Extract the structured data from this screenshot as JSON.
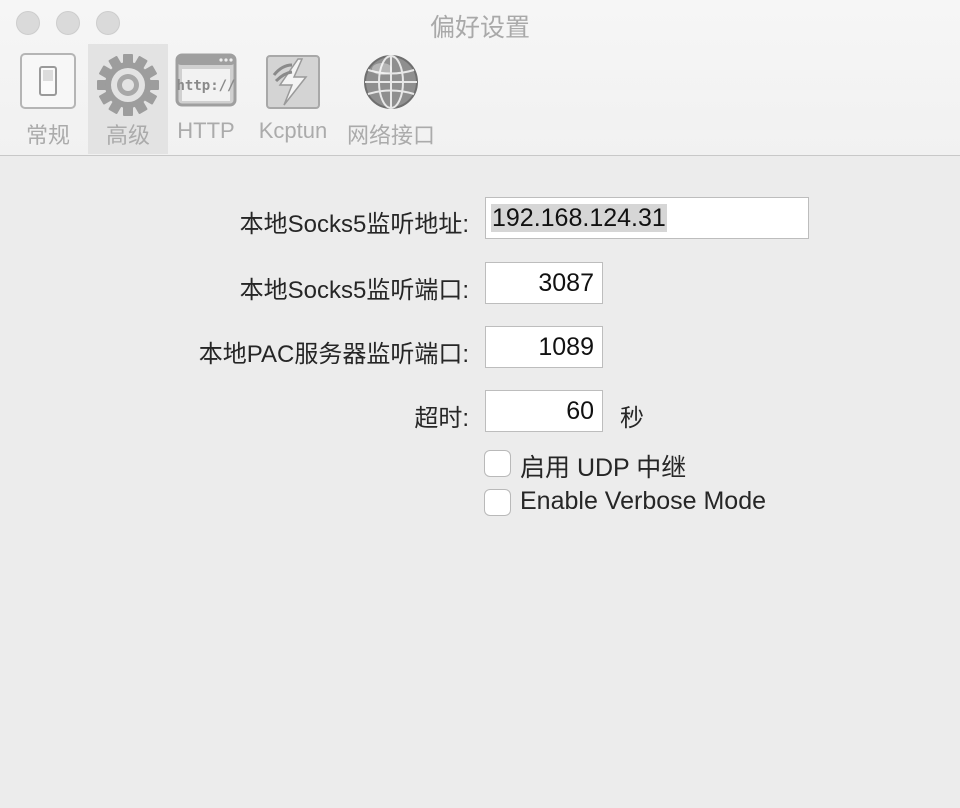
{
  "window": {
    "title": "偏好设置"
  },
  "toolbar": {
    "tabs": [
      {
        "label": "常规",
        "icon": "switch-icon"
      },
      {
        "label": "高级",
        "icon": "gear-icon",
        "active": true
      },
      {
        "label": "HTTP",
        "icon": "http-icon",
        "icon_text": "http://"
      },
      {
        "label": "Kcptun",
        "icon": "kcptun-icon"
      },
      {
        "label": "网络接口",
        "icon": "globe-icon"
      }
    ]
  },
  "form": {
    "socks5_address": {
      "label": "本地Socks5监听地址:",
      "value": "192.168.124.31"
    },
    "socks5_port": {
      "label": "本地Socks5监听端口:",
      "value": "3087"
    },
    "pac_port": {
      "label": "本地PAC服务器监听端口:",
      "value": "1089"
    },
    "timeout": {
      "label": "超时:",
      "value": "60",
      "unit": "秒"
    },
    "udp_relay": {
      "label": "启用 UDP 中继",
      "checked": false
    },
    "verbose": {
      "label": "Enable Verbose Mode",
      "checked": false
    }
  },
  "colors": {
    "window_bg": "#ececec",
    "toolbar_bg": "#f3f3f3",
    "icon_gray": "#9d9d9d"
  }
}
